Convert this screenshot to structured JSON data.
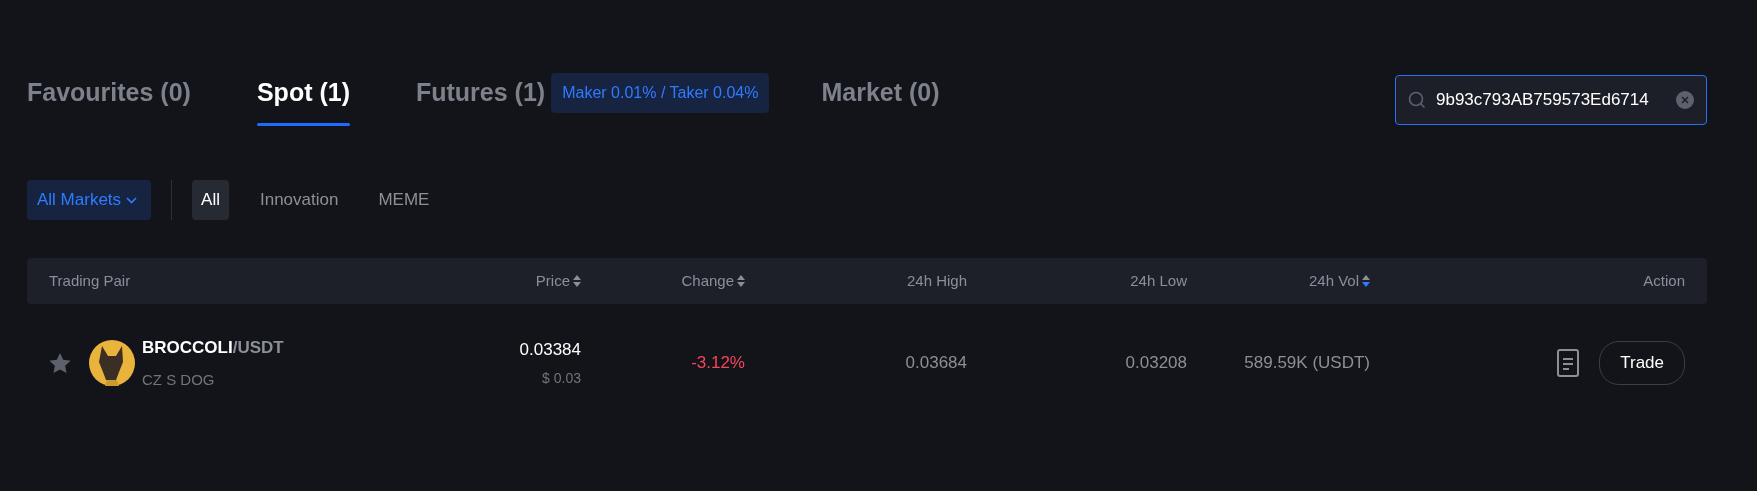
{
  "tabs": [
    {
      "label": "Favourites (0)",
      "selected": false
    },
    {
      "label": "Spot (1)",
      "selected": true
    },
    {
      "label": "Futures (1)",
      "selected": false,
      "badge": "Maker 0.01% / Taker 0.04%"
    },
    {
      "label": "Market (0)",
      "selected": false
    }
  ],
  "search": {
    "value": "9b93c793AB759573Ed6714"
  },
  "market_dropdown": {
    "label": "All Markets"
  },
  "filters": [
    {
      "label": "All",
      "selected": true
    },
    {
      "label": "Innovation",
      "selected": false
    },
    {
      "label": "MEME",
      "selected": false
    }
  ],
  "table": {
    "columns": [
      {
        "label": "Trading Pair"
      },
      {
        "label": "Price",
        "sortable": true,
        "sorted": false
      },
      {
        "label": "Change",
        "sortable": true,
        "sorted": false
      },
      {
        "label": "24h High"
      },
      {
        "label": "24h Low"
      },
      {
        "label": "24h Vol",
        "sortable": true,
        "sorted": true
      },
      {
        "label": "Action"
      }
    ],
    "rows": [
      {
        "favourite": false,
        "base": "BROCCOLI",
        "quote": "/USDT",
        "name": "CZ S DOG",
        "price": "0.03384",
        "price_usd": "$ 0.03",
        "change": "-3.12%",
        "negative": true,
        "high": "0.03684",
        "low": "0.03208",
        "volume": "589.59K (USDT)",
        "action": "Trade"
      }
    ]
  }
}
